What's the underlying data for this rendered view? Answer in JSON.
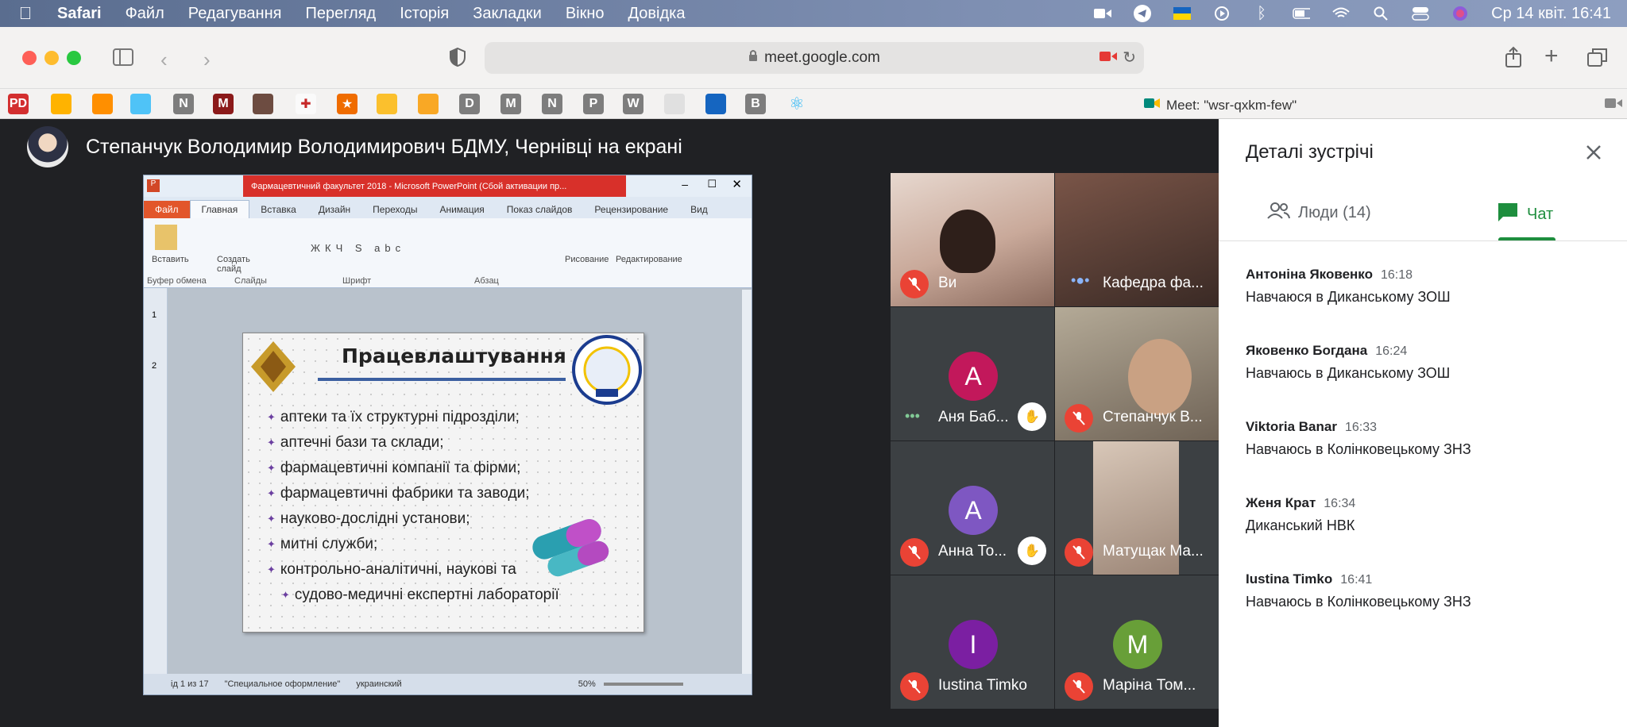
{
  "menubar": {
    "app": "Safari",
    "items": [
      "Файл",
      "Редагування",
      "Перегляд",
      "Історія",
      "Закладки",
      "Вікно",
      "Довідка"
    ],
    "datetime": "Ср 14 квіт.  16:41"
  },
  "browser": {
    "url": "meet.google.com",
    "tab_title": "Meet: \"wsr-qxkm-few\""
  },
  "bookmarks": [
    "PD",
    "",
    "",
    "",
    "N",
    "M",
    "",
    "",
    "",
    "",
    "",
    "D",
    "M",
    "N",
    "P",
    "W",
    "",
    "",
    "B",
    ""
  ],
  "presentation": {
    "presenter": "Степанчук Володимир Володимирович БДМУ, Чернівці на екрані",
    "ppt_title": "Фармацевтичний факультет 2018  -  Microsoft PowerPoint (Сбой активации пр...",
    "tabs": [
      "Файл",
      "Главная",
      "Вставка",
      "Дизайн",
      "Переходы",
      "Анимация",
      "Показ слайдов",
      "Рецензирование",
      "Вид"
    ],
    "groups": [
      "Буфер обмена",
      "Слайды",
      "Шрифт",
      "Абзац",
      "Рисование",
      "Редактирование"
    ],
    "ribbon_buttons": [
      "Вставить",
      "Создать слайд",
      "Рисование",
      "Редактирование"
    ],
    "slide_title": "Працевлаштування",
    "bullets": [
      "аптеки та їх структурні підрозділи;",
      "аптечні бази та склади;",
      "фармацевтичні  компанії та фірми;",
      "фармацевтичні  фабрики та заводи;",
      "науково-дослідні  установи;",
      "митні  служби;",
      "контрольно-аналітичні,  наукові та",
      "судово-медичні  експертні  лабораторії"
    ],
    "status": [
      "ід 1 из 17",
      "\"Специальное оформление\"",
      "украинский",
      "50%"
    ],
    "thumbs": [
      "1",
      "2"
    ]
  },
  "participants": [
    {
      "name": "Ви",
      "muted": true,
      "video": true
    },
    {
      "name": "Кафедра фа...",
      "muted": false,
      "video": true
    },
    {
      "name": "Аня Баб...",
      "letter": "А",
      "color": "#c2185b",
      "hand": true
    },
    {
      "name": "Степанчук В...",
      "muted": true,
      "video": true
    },
    {
      "name": "Анна То...",
      "letter": "А",
      "color": "#7e57c2",
      "hand": true
    },
    {
      "name": "Матущак Ма...",
      "muted": true,
      "video": true
    },
    {
      "name": "Iustina Timko",
      "letter": "I",
      "color": "#7b1fa2"
    },
    {
      "name": "Маріна Том...",
      "letter": "M",
      "color": "#689f38"
    }
  ],
  "panel": {
    "title": "Деталі зустрічі",
    "people_tab": "Люди (14)",
    "chat_tab": "Чат",
    "messages": [
      {
        "who": "Антоніна Яковенко",
        "time": "16:18",
        "text": "Навчаюся в Диканському ЗОШ"
      },
      {
        "who": "Яковенко Богдана",
        "time": "16:24",
        "text": "Навчаюсь в Диканському ЗОШ"
      },
      {
        "who": "Viktoria Banar",
        "time": "16:33",
        "text": "Навчаюсь в Колінковецькому ЗНЗ"
      },
      {
        "who": "Женя Крат",
        "time": "16:34",
        "text": "Диканський НВК"
      },
      {
        "who": "Iustina Timko",
        "time": "16:41",
        "text": "Навчаюсь в Колінковецькому ЗНЗ"
      }
    ]
  }
}
